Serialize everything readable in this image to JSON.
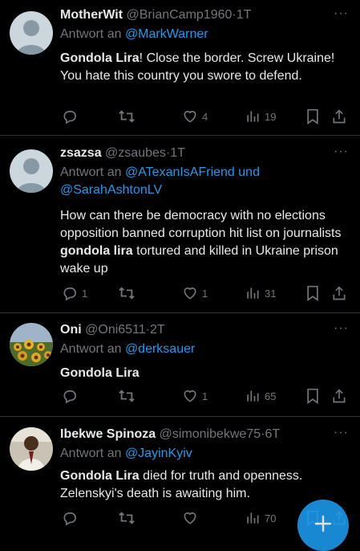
{
  "tweets": [
    {
      "name": "MotherWit",
      "handle": "@BrianCamp1960",
      "time": "1T",
      "reply_prefix": "Antwort an",
      "reply_to": "@MarkWarner",
      "body_bold": "Gondola Lira",
      "body_rest": "! Close the border. Screw Ukraine! You hate this country you swore to defend.",
      "replies": "",
      "retweets": "",
      "likes": "4",
      "views": "19",
      "avatar": "default-avatar"
    },
    {
      "name": "zsazsa",
      "handle": "@zsaubes",
      "time": "1T",
      "reply_prefix": "Antwort an",
      "reply_to": "@ATexanIsAFriend und @SarahAshtonLV",
      "body_pre": "How can there be democracy with no elections opposition banned corruption hit list on journalists ",
      "body_bold": "gondola lira",
      "body_rest": " tortured and killed in Ukraine prison wake up",
      "replies": "1",
      "retweets": "",
      "likes": "1",
      "views": "31",
      "avatar": "default-avatar"
    },
    {
      "name": "Oni",
      "handle": "@Oni6511",
      "time": "2T",
      "reply_prefix": "Antwort an",
      "reply_to": "@derksauer",
      "body_bold": "Gondola Lira",
      "body_rest": "",
      "replies": "",
      "retweets": "",
      "likes": "1",
      "views": "65",
      "avatar": "sunflower-photo"
    },
    {
      "name": "Ibekwe Spinoza",
      "handle": "@simonibekwe75",
      "time": "6T",
      "reply_prefix": "Antwort an",
      "reply_to": "@JayinKyiv",
      "body_bold": "Gondola Lira",
      "body_rest": " died for truth and openness. Zelenskyi's death is awaiting him.",
      "replies": "",
      "retweets": "",
      "likes": "",
      "views": "70",
      "avatar": "person-photo"
    }
  ],
  "separator": "·",
  "more_glyph": "···",
  "fab_icon": "compose-plus-icon",
  "colors": {
    "background": "#000000",
    "text": "#e7e9ea",
    "muted": "#71767b",
    "link": "#1d9bf0",
    "divider": "#2f3336",
    "accent": "#1d9bf0"
  }
}
